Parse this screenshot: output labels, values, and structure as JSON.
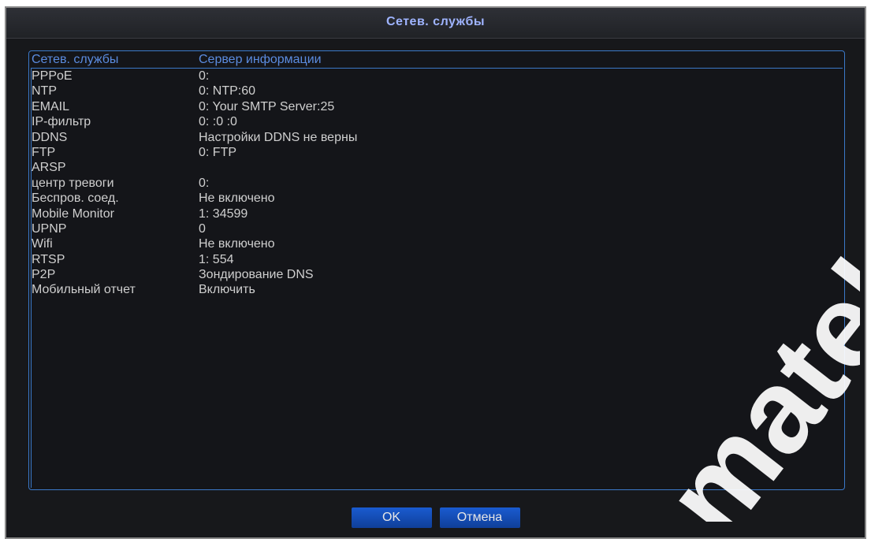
{
  "window": {
    "title": "Сетев. службы"
  },
  "table": {
    "headers": [
      "Сетев. службы",
      "Сервер информации"
    ],
    "rows": [
      {
        "service": "PPPoE",
        "info": "0:"
      },
      {
        "service": "NTP",
        "info": "0: NTP:60"
      },
      {
        "service": "EMAIL",
        "info": "0: Your SMTP Server:25"
      },
      {
        "service": "IP-фильтр",
        "info": "0: :0 :0"
      },
      {
        "service": "DDNS",
        "info": "Настройки DDNS не верны"
      },
      {
        "service": "FTP",
        "info": "0: FTP"
      },
      {
        "service": "ARSP",
        "info": ""
      },
      {
        "service": "центр тревоги",
        "info": "0:"
      },
      {
        "service": "Беспров. соед.",
        "info": "Не включено"
      },
      {
        "service": "Mobile Monitor",
        "info": "1: 34599"
      },
      {
        "service": "UPNP",
        "info": "0"
      },
      {
        "service": "Wifi",
        "info": "Не включено"
      },
      {
        "service": "RTSP",
        "info": "1: 554"
      },
      {
        "service": "P2P",
        "info": "Зондирование DNS"
      },
      {
        "service": "Мобильный отчет",
        "info": "Включить"
      }
    ]
  },
  "buttons": {
    "ok": "OK",
    "cancel": "Отмена"
  },
  "watermark": {
    "text": "matek"
  },
  "colors": {
    "accent": "#3b79c9",
    "title": "#9fb4ff",
    "button": "#1a5bd0"
  }
}
